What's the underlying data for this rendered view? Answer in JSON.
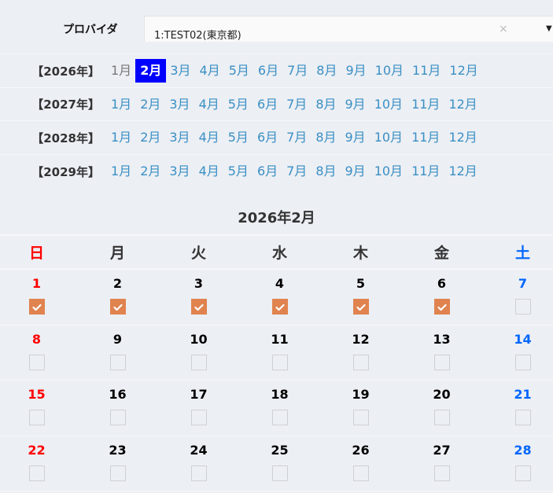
{
  "provider": {
    "label": "プロバイダ",
    "value": "1:TEST02(東京都)",
    "clear": "×",
    "arrow": "▼"
  },
  "years": [
    {
      "label": "【2026年】",
      "months": [
        "1月",
        "2月",
        "3月",
        "4月",
        "5月",
        "6月",
        "7月",
        "8月",
        "9月",
        "10月",
        "11月",
        "12月"
      ],
      "selected": 1,
      "past": [
        0
      ]
    },
    {
      "label": "【2027年】",
      "months": [
        "1月",
        "2月",
        "3月",
        "4月",
        "5月",
        "6月",
        "7月",
        "8月",
        "9月",
        "10月",
        "11月",
        "12月"
      ],
      "selected": -1,
      "past": []
    },
    {
      "label": "【2028年】",
      "months": [
        "1月",
        "2月",
        "3月",
        "4月",
        "5月",
        "6月",
        "7月",
        "8月",
        "9月",
        "10月",
        "11月",
        "12月"
      ],
      "selected": -1,
      "past": []
    },
    {
      "label": "【2029年】",
      "months": [
        "1月",
        "2月",
        "3月",
        "4月",
        "5月",
        "6月",
        "7月",
        "8月",
        "9月",
        "10月",
        "11月",
        "12月"
      ],
      "selected": -1,
      "past": []
    }
  ],
  "calendar": {
    "title": "2026年2月",
    "weekdays": [
      "日",
      "月",
      "火",
      "水",
      "木",
      "金",
      "土"
    ],
    "weeks": [
      [
        {
          "d": "1",
          "c": true
        },
        {
          "d": "2",
          "c": true
        },
        {
          "d": "3",
          "c": true
        },
        {
          "d": "4",
          "c": true
        },
        {
          "d": "5",
          "c": true
        },
        {
          "d": "6",
          "c": true
        },
        {
          "d": "7",
          "c": false
        }
      ],
      [
        {
          "d": "8",
          "c": false
        },
        {
          "d": "9",
          "c": false
        },
        {
          "d": "10",
          "c": false
        },
        {
          "d": "11",
          "c": false
        },
        {
          "d": "12",
          "c": false
        },
        {
          "d": "13",
          "c": false
        },
        {
          "d": "14",
          "c": false
        }
      ],
      [
        {
          "d": "15",
          "c": false
        },
        {
          "d": "16",
          "c": false
        },
        {
          "d": "17",
          "c": false
        },
        {
          "d": "18",
          "c": false
        },
        {
          "d": "19",
          "c": false
        },
        {
          "d": "20",
          "c": false
        },
        {
          "d": "21",
          "c": false
        }
      ],
      [
        {
          "d": "22",
          "c": false
        },
        {
          "d": "23",
          "c": false
        },
        {
          "d": "24",
          "c": false
        },
        {
          "d": "25",
          "c": false
        },
        {
          "d": "26",
          "c": false
        },
        {
          "d": "27",
          "c": false
        },
        {
          "d": "28",
          "c": false
        }
      ]
    ]
  },
  "colors": {
    "selected": "#0000ff",
    "checked": "#e0834f",
    "sunday": "#ff0000",
    "saturday": "#0066ff",
    "link": "#3a8fc4"
  }
}
